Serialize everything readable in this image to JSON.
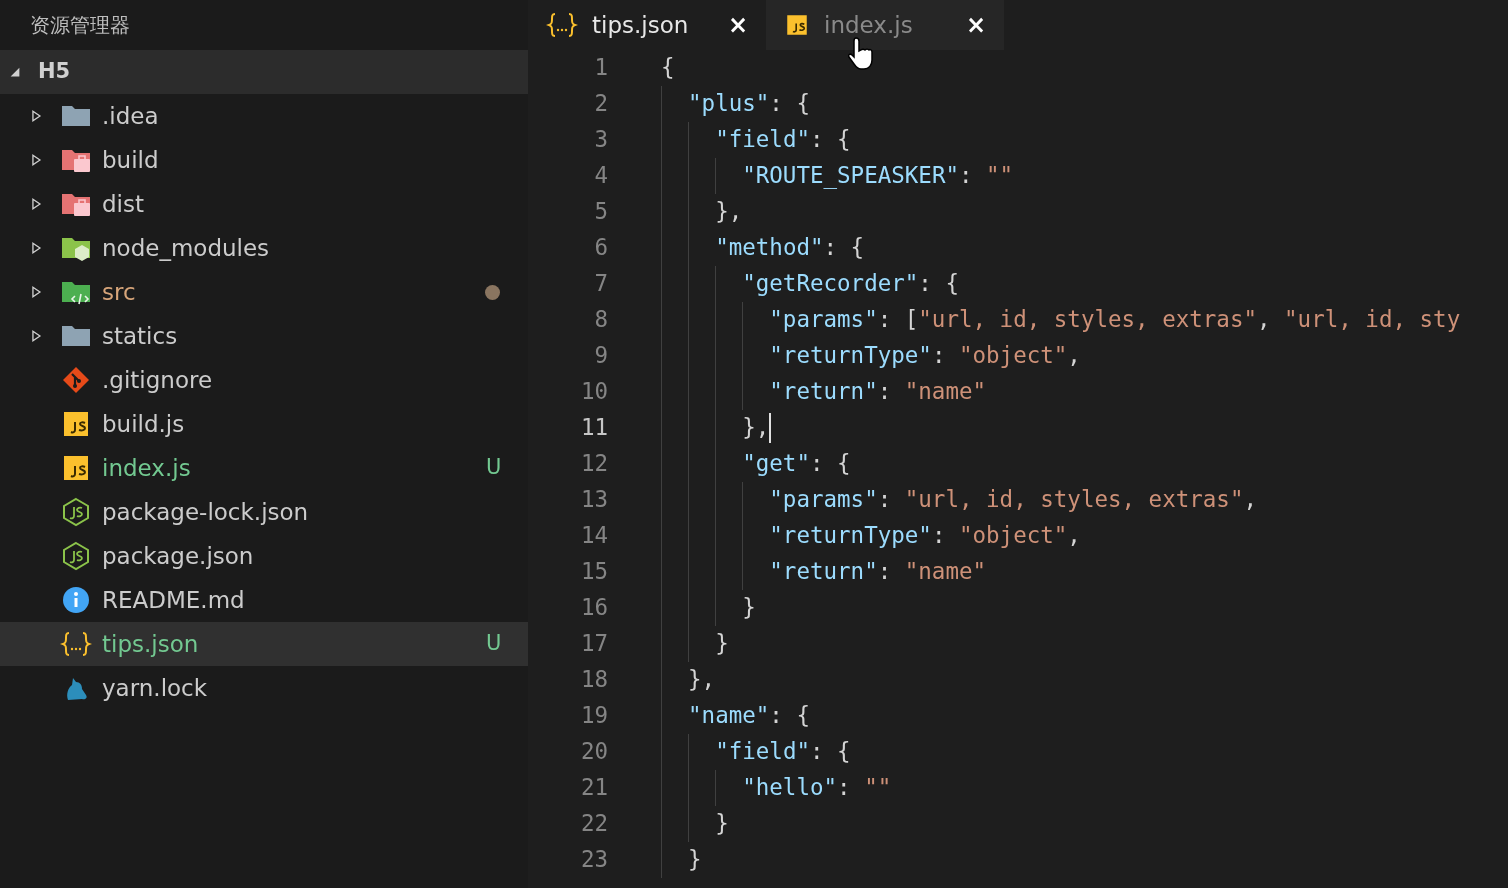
{
  "explorer": {
    "title": "资源管理器",
    "root": {
      "label": "H5",
      "expanded": true
    },
    "items": [
      {
        "name": ".idea",
        "kind": "folder",
        "expanded": false,
        "selected": false,
        "modified": false
      },
      {
        "name": "build",
        "kind": "packagefolder",
        "expanded": false,
        "selected": false,
        "modified": false
      },
      {
        "name": "dist",
        "kind": "packagefolder",
        "expanded": false,
        "selected": false,
        "modified": false
      },
      {
        "name": "node_modules",
        "kind": "nodefolder",
        "expanded": false,
        "selected": false,
        "modified": false
      },
      {
        "name": "src",
        "kind": "sourcefolder",
        "expanded": false,
        "selected": false,
        "modified": true
      },
      {
        "name": "statics",
        "kind": "folder",
        "expanded": false,
        "selected": false,
        "modified": false
      },
      {
        "name": ".gitignore",
        "kind": "gitfile",
        "selected": false,
        "modified": false
      },
      {
        "name": "build.js",
        "kind": "jsfile",
        "selected": false,
        "modified": false
      },
      {
        "name": "index.js",
        "kind": "jsfile",
        "selected": false,
        "modified": false,
        "badge": "U"
      },
      {
        "name": "package-lock.json",
        "kind": "nodefile",
        "selected": false,
        "modified": false
      },
      {
        "name": "package.json",
        "kind": "nodefile",
        "selected": false,
        "modified": false
      },
      {
        "name": "README.md",
        "kind": "infofile",
        "selected": false,
        "modified": false
      },
      {
        "name": "tips.json",
        "kind": "jsonfile",
        "selected": true,
        "modified": false,
        "badge": "U"
      },
      {
        "name": "yarn.lock",
        "kind": "yarnfile",
        "selected": false,
        "modified": false
      }
    ]
  },
  "tabs": [
    {
      "label": "tips.json",
      "kind": "jsonfile",
      "selected": true,
      "close": "×"
    },
    {
      "label": "index.js",
      "kind": "jsfile",
      "selected": false,
      "close": "×"
    }
  ],
  "editor": {
    "lines": [
      {
        "number": "1",
        "current": false,
        "tokens": [
          {
            "kind": "punct",
            "text": "{"
          }
        ]
      },
      {
        "number": "2",
        "current": false,
        "tokens": [
          {
            "kind": "key",
            "text": "  \"plus\""
          },
          {
            "kind": "punct",
            "text": ": {"
          }
        ]
      },
      {
        "number": "3",
        "current": false,
        "tokens": [
          {
            "kind": "key",
            "text": "    \"field\""
          },
          {
            "kind": "punct",
            "text": ": {"
          }
        ]
      },
      {
        "number": "4",
        "current": false,
        "tokens": [
          {
            "kind": "key",
            "text": "      \"ROUTE_SPEASKER\""
          },
          {
            "kind": "punct",
            "text": ": "
          },
          {
            "kind": "string",
            "text": "\"\""
          }
        ]
      },
      {
        "number": "5",
        "current": false,
        "tokens": [
          {
            "kind": "punct",
            "text": "    },"
          }
        ]
      },
      {
        "number": "6",
        "current": false,
        "tokens": [
          {
            "kind": "key",
            "text": "    \"method\""
          },
          {
            "kind": "punct",
            "text": ": {"
          }
        ]
      },
      {
        "number": "7",
        "current": false,
        "tokens": [
          {
            "kind": "key",
            "text": "      \"getRecorder\""
          },
          {
            "kind": "punct",
            "text": ": {"
          }
        ]
      },
      {
        "number": "8",
        "current": false,
        "tokens": [
          {
            "kind": "key",
            "text": "        \"params\""
          },
          {
            "kind": "punct",
            "text": ": ["
          },
          {
            "kind": "string",
            "text": "\"url, id, styles, extras\""
          },
          {
            "kind": "punct",
            "text": ", "
          },
          {
            "kind": "string",
            "text": "\"url, id, sty"
          }
        ]
      },
      {
        "number": "9",
        "current": false,
        "tokens": [
          {
            "kind": "key",
            "text": "        \"returnType\""
          },
          {
            "kind": "punct",
            "text": ": "
          },
          {
            "kind": "string",
            "text": "\"object\""
          },
          {
            "kind": "punct",
            "text": ","
          }
        ]
      },
      {
        "number": "10",
        "current": false,
        "tokens": [
          {
            "kind": "key",
            "text": "        \"return\""
          },
          {
            "kind": "punct",
            "text": ": "
          },
          {
            "kind": "string",
            "text": "\"name\""
          }
        ]
      },
      {
        "number": "11",
        "current": true,
        "tokens": [
          {
            "kind": "punct",
            "text": "      },"
          }
        ]
      },
      {
        "number": "12",
        "current": false,
        "tokens": [
          {
            "kind": "key",
            "text": "      \"get\""
          },
          {
            "kind": "punct",
            "text": ": {"
          }
        ]
      },
      {
        "number": "13",
        "current": false,
        "tokens": [
          {
            "kind": "key",
            "text": "        \"params\""
          },
          {
            "kind": "punct",
            "text": ": "
          },
          {
            "kind": "string",
            "text": "\"url, id, styles, extras\""
          },
          {
            "kind": "punct",
            "text": ","
          }
        ]
      },
      {
        "number": "14",
        "current": false,
        "tokens": [
          {
            "kind": "key",
            "text": "        \"returnType\""
          },
          {
            "kind": "punct",
            "text": ": "
          },
          {
            "kind": "string",
            "text": "\"object\""
          },
          {
            "kind": "punct",
            "text": ","
          }
        ]
      },
      {
        "number": "15",
        "current": false,
        "tokens": [
          {
            "kind": "key",
            "text": "        \"return\""
          },
          {
            "kind": "punct",
            "text": ": "
          },
          {
            "kind": "string",
            "text": "\"name\""
          }
        ]
      },
      {
        "number": "16",
        "current": false,
        "tokens": [
          {
            "kind": "punct",
            "text": "      }"
          }
        ]
      },
      {
        "number": "17",
        "current": false,
        "tokens": [
          {
            "kind": "punct",
            "text": "    }"
          }
        ]
      },
      {
        "number": "18",
        "current": false,
        "tokens": [
          {
            "kind": "punct",
            "text": "  },"
          }
        ]
      },
      {
        "number": "19",
        "current": false,
        "tokens": [
          {
            "kind": "key",
            "text": "  \"name\""
          },
          {
            "kind": "punct",
            "text": ": {"
          }
        ]
      },
      {
        "number": "20",
        "current": false,
        "tokens": [
          {
            "kind": "key",
            "text": "    \"field\""
          },
          {
            "kind": "punct",
            "text": ": {"
          }
        ]
      },
      {
        "number": "21",
        "current": false,
        "tokens": [
          {
            "kind": "key",
            "text": "      \"hello\""
          },
          {
            "kind": "punct",
            "text": ": "
          },
          {
            "kind": "string",
            "text": "\"\""
          }
        ]
      },
      {
        "number": "22",
        "current": false,
        "tokens": [
          {
            "kind": "punct",
            "text": "    }"
          }
        ]
      },
      {
        "number": "23",
        "current": false,
        "tokens": [
          {
            "kind": "punct",
            "text": "  }"
          }
        ]
      }
    ]
  }
}
